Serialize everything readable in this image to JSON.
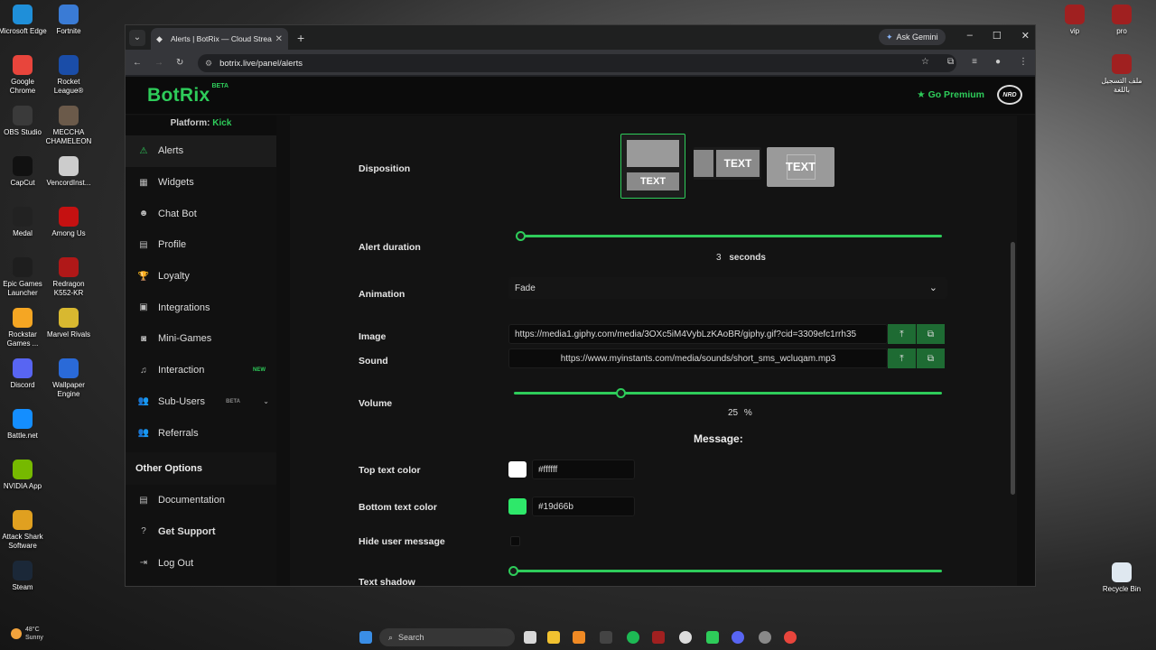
{
  "desktop": {
    "icons_left": [
      {
        "label": "Microsoft Edge",
        "color": "#1f8fd9"
      },
      {
        "label": "Google Chrome",
        "color": "#e8453c"
      },
      {
        "label": "OBS Studio",
        "color": "#3a3a3a"
      },
      {
        "label": "CapCut",
        "color": "#111111"
      },
      {
        "label": "Medal",
        "color": "#222222"
      },
      {
        "label": "Epic Games Launcher",
        "color": "#1e1e1e"
      },
      {
        "label": "Rockstar Games ...",
        "color": "#f5a623"
      },
      {
        "label": "Discord",
        "color": "#5865f2"
      },
      {
        "label": "Battle.net",
        "color": "#148eff"
      },
      {
        "label": "NVIDIA App",
        "color": "#76b900"
      },
      {
        "label": "Attack Shark Software",
        "color": "#e0a020"
      },
      {
        "label": "Steam",
        "color": "#1b2838"
      }
    ],
    "icons_col2": [
      {
        "label": "Fortnite",
        "color": "#3a7bd5"
      },
      {
        "label": "Rocket League®",
        "color": "#1a4da8"
      },
      {
        "label": "MECCHA CHAMELEON",
        "color": "#6b5a4a"
      },
      {
        "label": "VencordInst...",
        "color": "#cccccc"
      },
      {
        "label": "Among Us",
        "color": "#c51111"
      },
      {
        "label": "Redragon K552-KR",
        "color": "#b01818"
      },
      {
        "label": "Marvel Rivals",
        "color": "#d8b830"
      },
      {
        "label": "Wallpaper Engine",
        "color": "#2a6ad8"
      }
    ],
    "icons_right": [
      {
        "label": "vip",
        "color": "#a02020"
      },
      {
        "label": "pro",
        "color": "#a02020"
      },
      {
        "label": "ملف التسجيل باللغة",
        "color": "#a02020"
      }
    ],
    "recycle_bin": "Recycle Bin",
    "weather_temp": "48°C",
    "weather_desc": "Sunny"
  },
  "browser": {
    "tab_title": "Alerts | BotRix — Cloud Stream...",
    "url": "botrix.live/panel/alerts",
    "ask_gemini": "Ask Gemini"
  },
  "header": {
    "logo": "BotRix",
    "logo_badge": "BETA",
    "go_premium": "Go Premium",
    "nrd": "NRD"
  },
  "sidebar": {
    "platform_label": "Platform:",
    "platform_value": "Kick",
    "items": [
      {
        "label": "Alerts",
        "icon": "⚠",
        "active": true
      },
      {
        "label": "Widgets",
        "icon": "▦"
      },
      {
        "label": "Chat Bot",
        "icon": "☻"
      },
      {
        "label": "Profile",
        "icon": "▤"
      },
      {
        "label": "Loyalty",
        "icon": "🏆"
      },
      {
        "label": "Integrations",
        "icon": "▣"
      },
      {
        "label": "Mini-Games",
        "icon": "◙"
      },
      {
        "label": "Interaction",
        "icon": "♫",
        "badge": "NEW"
      },
      {
        "label": "Sub-Users",
        "icon": "👥",
        "badge": "BETA"
      },
      {
        "label": "Referrals",
        "icon": "👥"
      }
    ],
    "other_options": "Other Options",
    "other_items": [
      {
        "label": "Documentation",
        "icon": "▤"
      },
      {
        "label": "Get Support",
        "icon": "?"
      },
      {
        "label": "Log Out",
        "icon": "⇥"
      }
    ]
  },
  "settings": {
    "disposition_label": "Disposition",
    "disposition_text": "TEXT",
    "alert_duration_label": "Alert duration",
    "alert_duration_value": "3",
    "alert_duration_unit": "seconds",
    "alert_duration_fraction": 0.0,
    "animation_label": "Animation",
    "animation_value": "Fade",
    "image_label": "Image",
    "image_url": "https://media1.giphy.com/media/3OXc5iM4VybLzKAoBR/giphy.gif?cid=3309efc1rrh35",
    "sound_label": "Sound",
    "sound_url": "https://www.myinstants.com/media/sounds/short_sms_wcluqam.mp3",
    "volume_label": "Volume",
    "volume_value": "25",
    "volume_unit": "%",
    "volume_fraction": 0.25,
    "message_heading": "Message:",
    "top_text_color_label": "Top text color",
    "top_text_color": "#ffffff",
    "bottom_text_color_label": "Bottom text color",
    "bottom_text_color": "#19d66b",
    "hide_user_message_label": "Hide user message",
    "text_shadow_label": "Text shadow"
  },
  "taskbar": {
    "search_placeholder": "Search"
  }
}
